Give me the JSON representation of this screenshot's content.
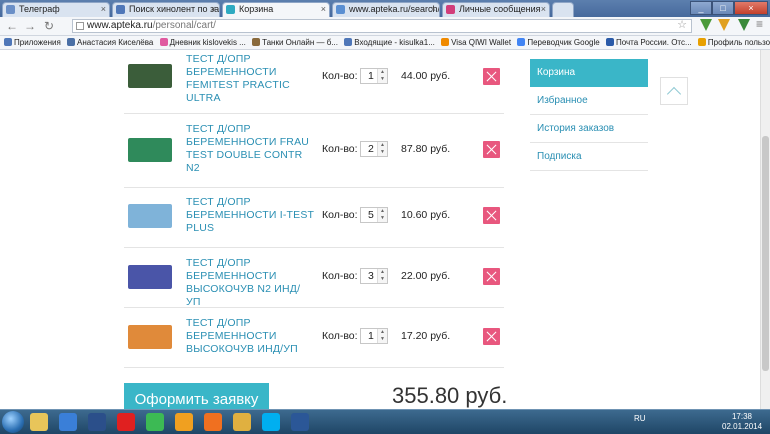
{
  "browser": {
    "tabs": [
      {
        "label": "Телеграф",
        "color": "#6a8fc7"
      },
      {
        "label": "Поиск хинолент по запр",
        "color": "#4f77b8"
      },
      {
        "label": "Корзина",
        "color": "#2eaac1"
      },
      {
        "label": "www.apteka.ru/search/?q",
        "color": "#5a8fd2"
      },
      {
        "label": "Личные сообщения",
        "color": "#d23d7a"
      }
    ],
    "url_host": "www.apteka.ru",
    "url_path": "/personal/cart/",
    "bookmarks": [
      {
        "label": "Приложения",
        "color": "#4f77b8"
      },
      {
        "label": "Анастасия Киселёва",
        "color": "#4a6fa5"
      },
      {
        "label": "Дневник kislovekis ...",
        "color": "#e05aa0"
      },
      {
        "label": "Танки Онлайн — б...",
        "color": "#8a6a3c"
      },
      {
        "label": "Входящие - kisulka1...",
        "color": "#4f77b8"
      },
      {
        "label": "Visa QIWI Wallet",
        "color": "#f08a00"
      },
      {
        "label": "Переводчик Google",
        "color": "#4285f4"
      },
      {
        "label": "Почта России. Отс...",
        "color": "#2a5aa8"
      },
      {
        "label": "Профиль пользова...",
        "color": "#e8a000"
      }
    ]
  },
  "cart": {
    "qty_label": "Кол-во:",
    "items": [
      {
        "name": "ТЕСТ Д/ОПР БЕРЕМЕННОСТИ FEMITEST PRACTIC ULTRA",
        "qty": "1",
        "price": "44.00 руб.",
        "thumb_color": "#3b5d3a"
      },
      {
        "name": "ТЕСТ Д/ОПР БЕРЕМЕННОСТИ FRAU TEST DOUBLE CONTR N2",
        "qty": "2",
        "price": "87.80 руб.",
        "thumb_color": "#2f8a5b"
      },
      {
        "name": "ТЕСТ Д/ОПР БЕРЕМЕННОСТИ I-TEST PLUS",
        "qty": "5",
        "price": "10.60 руб.",
        "thumb_color": "#7fb3d9"
      },
      {
        "name": "ТЕСТ Д/ОПР БЕРЕМЕННОСТИ ВЫСОКОЧУВ N2 ИНД/УП",
        "qty": "3",
        "price": "22.00 руб.",
        "thumb_color": "#4a55a8"
      },
      {
        "name": "ТЕСТ Д/ОПР БЕРЕМЕННОСТИ ВЫСОКОЧУВ ИНД/УП",
        "qty": "1",
        "price": "17.20 руб.",
        "thumb_color": "#e08a3a"
      }
    ],
    "order_button": "Оформить заявку",
    "total": "355.80 руб."
  },
  "sidebar": {
    "items": [
      {
        "label": "Корзина",
        "active": true
      },
      {
        "label": "Избранное",
        "active": false
      },
      {
        "label": "История заказов",
        "active": false
      },
      {
        "label": "Подписка",
        "active": false
      }
    ]
  },
  "taskbar": {
    "lang": "RU",
    "time": "17:38",
    "date": "02.01.2014",
    "apps": [
      {
        "name": "explorer-icon",
        "color": "#e8c55a"
      },
      {
        "name": "media-player-icon",
        "color": "#3a7fd8"
      },
      {
        "name": "floppy-icon",
        "color": "#2b4f8a"
      },
      {
        "name": "yandex-icon",
        "color": "#e02020"
      },
      {
        "name": "chrome-icon",
        "color": "#3cba54"
      },
      {
        "name": "aimp-icon",
        "color": "#f0a020"
      },
      {
        "name": "media-icon",
        "color": "#f07020"
      },
      {
        "name": "folder-icon",
        "color": "#e0b040"
      },
      {
        "name": "skype-icon",
        "color": "#00aff0"
      },
      {
        "name": "word-icon",
        "color": "#2b5797"
      }
    ]
  }
}
